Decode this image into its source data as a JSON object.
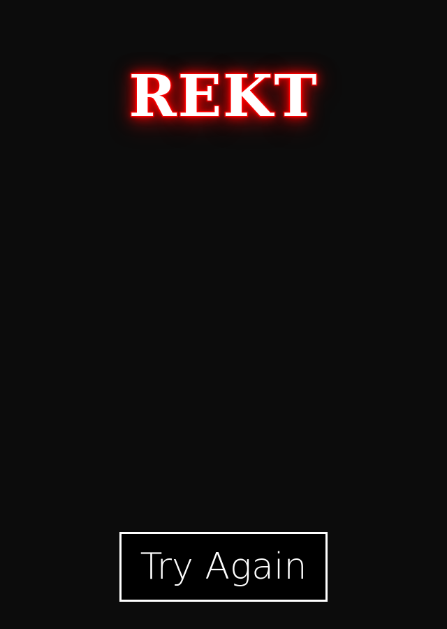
{
  "game_over": {
    "title": "REKT",
    "title_colors": {
      "fill": "#ffffff",
      "outline": "#e00000",
      "glow": "#ff0000"
    }
  },
  "actions": {
    "retry_label": "Try Again"
  },
  "colors": {
    "background": "#0c0c0c",
    "button_border": "#ffffff",
    "button_text": "#ffffff"
  }
}
